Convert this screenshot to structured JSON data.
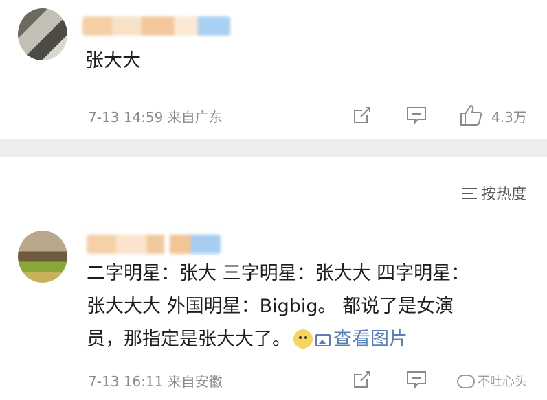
{
  "comments": [
    {
      "text_lines": [
        "张大大"
      ],
      "timestamp": "7-13 14:59",
      "source": "来自广东",
      "like_count": "4.3万",
      "icons": {
        "repost": "share-icon",
        "comment": "comment-icon",
        "like": "thumbs-up-icon"
      }
    },
    {
      "text_lines": [
        "二字明星：张大  三字明星：张大大  四字明星：",
        "张大大大  外国明星：Bigbig。  都说了是女演",
        "员，那指定是张大大了。"
      ],
      "view_image_label": "查看图片",
      "timestamp": "7-13 16:11",
      "source": "来自安徽",
      "icons": {
        "repost": "share-icon",
        "comment": "comment-icon",
        "emoji": "doge-emoji-icon",
        "image": "image-icon"
      }
    }
  ],
  "sort": {
    "label": "按热度",
    "icon": "sort-icon"
  },
  "watermark": {
    "label": "不吐心头",
    "icon": "wechat-icon"
  },
  "colors": {
    "link": "#5a7fb3",
    "meta": "#8a8a8a",
    "separator": "#eeeeee"
  }
}
